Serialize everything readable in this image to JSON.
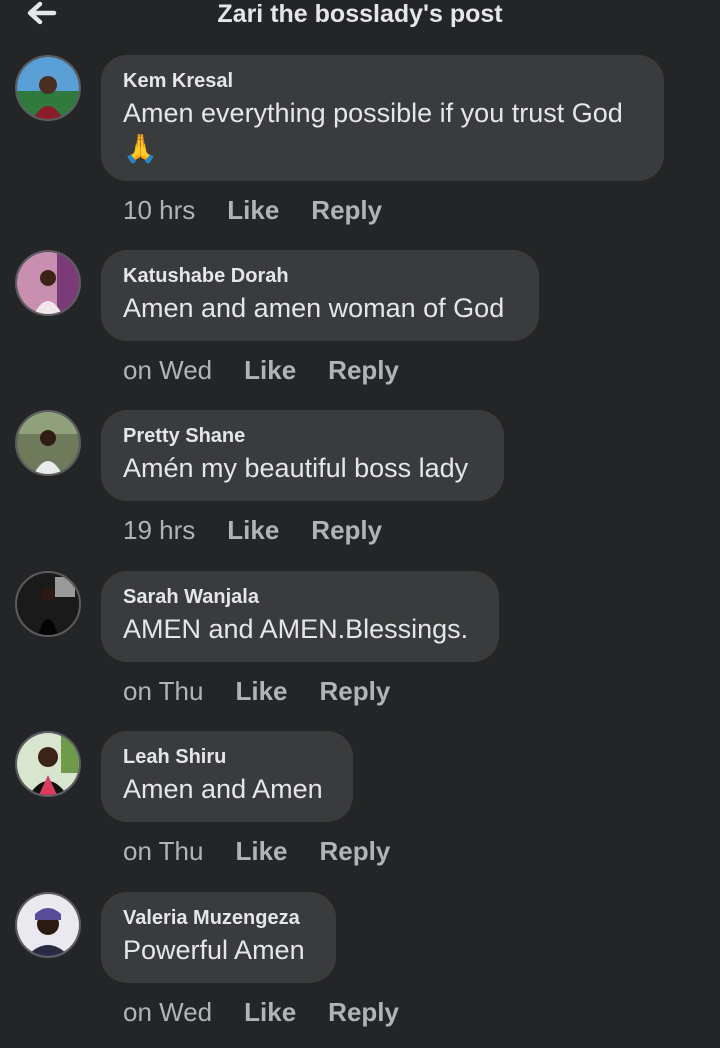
{
  "header": {
    "title": "Zari the bosslady's post",
    "back_icon": "arrow-left-icon"
  },
  "actions": {
    "like_label": "Like",
    "reply_label": "Reply"
  },
  "comments": [
    {
      "author": "Kem Kresal",
      "text": "Amen everything possible if you trust God",
      "emoji": "🙏",
      "time": "10 hrs"
    },
    {
      "author": "Katushabe Dorah",
      "text": "Amen and amen woman of God",
      "time": "on Wed"
    },
    {
      "author": "Pretty Shane",
      "text": "Amén my beautiful boss lady",
      "time": "19 hrs"
    },
    {
      "author": "Sarah Wanjala",
      "text": "AMEN and AMEN.Blessings.",
      "time": "on Thu"
    },
    {
      "author": "Leah Shiru",
      "text": "Amen and Amen",
      "time": "on Thu"
    },
    {
      "author": "Valeria Muzengeza",
      "text": "Powerful Amen",
      "time": "on Wed"
    }
  ]
}
